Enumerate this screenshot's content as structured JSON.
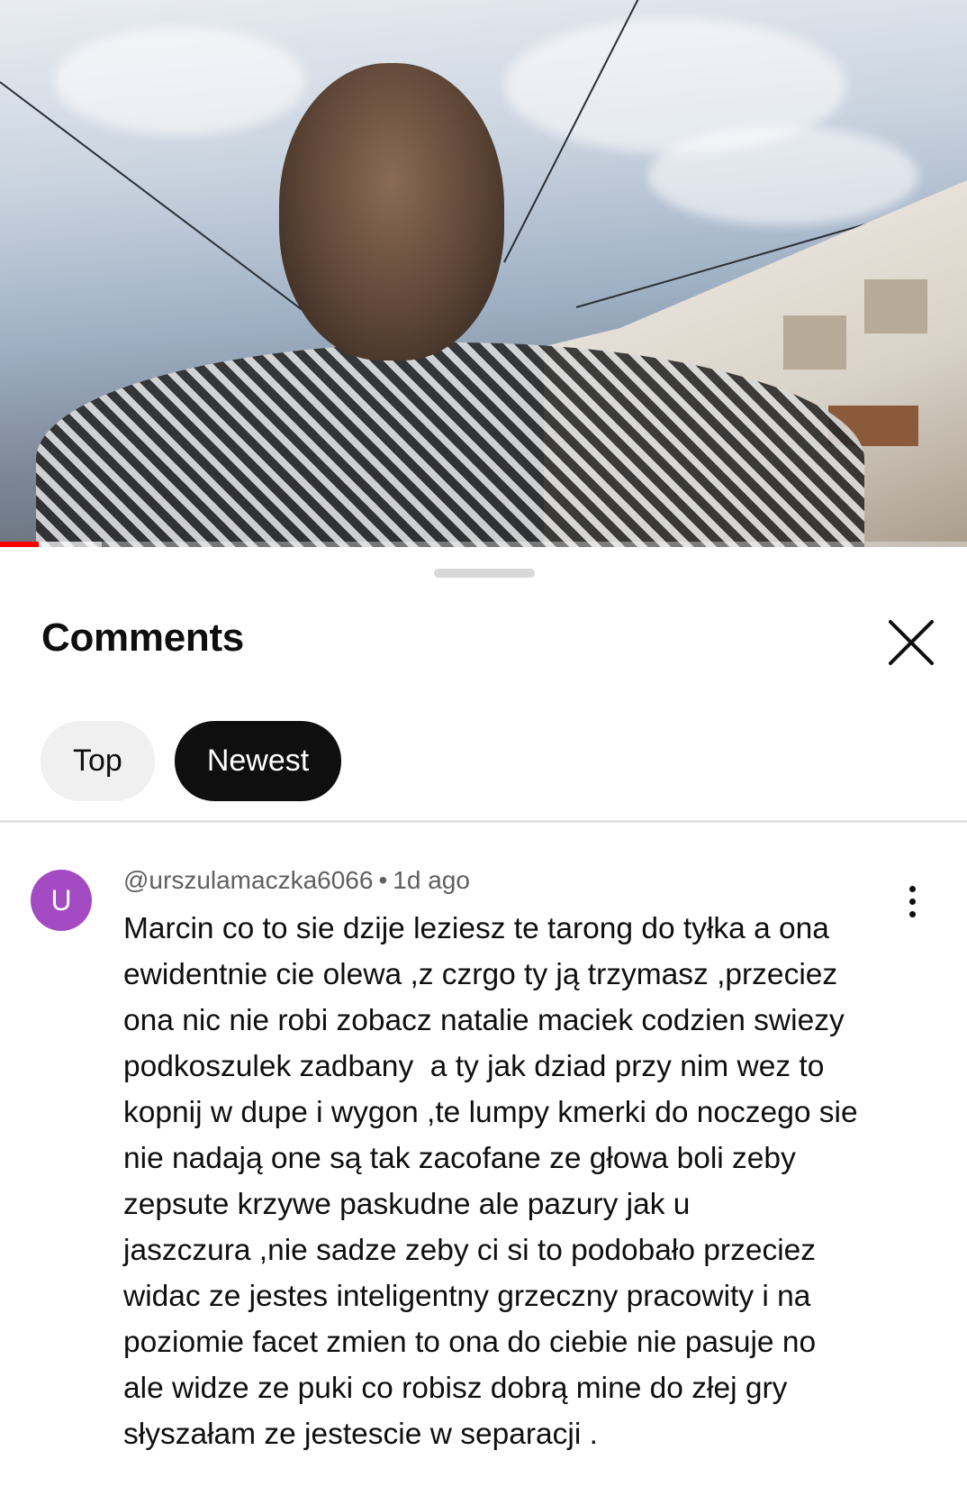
{
  "video": {
    "progress_played": 0.04,
    "progress_buffered": 0.105,
    "colors": {
      "played": "#ff0000"
    }
  },
  "comments_panel": {
    "title": "Comments",
    "close_icon": "close-icon",
    "sort_chips": [
      {
        "label": "Top",
        "selected": false
      },
      {
        "label": "Newest",
        "selected": true
      }
    ]
  },
  "comment": {
    "avatar_letter": "U",
    "avatar_color": "#a44bc4",
    "author": "@urszulamaczka6066",
    "separator": "•",
    "time": "1d ago",
    "text": "Marcin co to sie dzije leziesz te tarong do tyłka a ona\newidentnie cie olewa ,z czrgo ty ją trzymasz ,przeciez\nona nic nie robi zobacz natalie maciek codzien swiezy\npodkoszulek zadbany  a ty jak dziad przy nim wez to\nkopnij w dupe i wygon ,te lumpy kmerki do noczego sie\nnie nadają one są tak zacofane ze głowa boli zeby\nzepsute krzywe paskudne ale pazury jak u\njaszczura ,nie sadze zeby ci si to podobało przeciez\nwidac ze jestes inteligentny grzeczny pracowity i na\npoziomie facet zmien to ona do ciebie nie pasuje no\nale widze ze puki co robisz dobrą mine do złej gry\nsłyszałam ze jestescie w separacji .",
    "more_icon": "more-vertical-icon"
  }
}
